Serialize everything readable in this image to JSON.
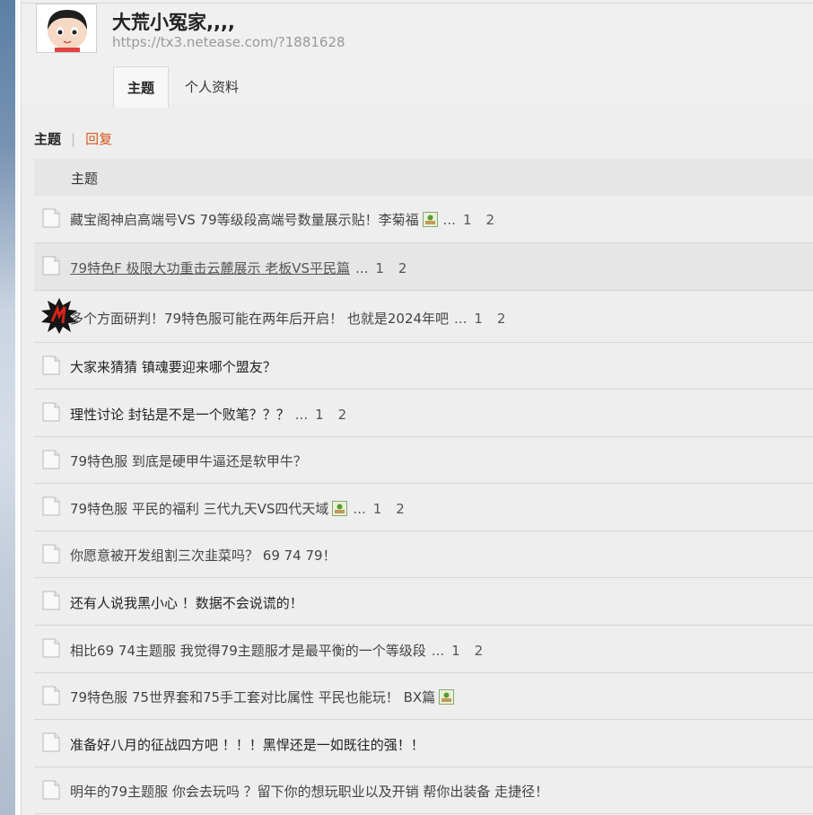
{
  "user": {
    "name": "大荒小冤家,,,,",
    "url": "https://tx3.netease.com/?1881628"
  },
  "tabs": [
    {
      "label": "主题",
      "active": true
    },
    {
      "label": "个人资料",
      "active": false
    }
  ],
  "subnav": {
    "main": "主题",
    "separator": "|",
    "reply": "回复"
  },
  "table": {
    "header": "主题"
  },
  "rows": [
    {
      "title": "藏宝阁神启高端号VS 79等级段高端号数量展示贴！李菊福",
      "has_image": true,
      "ellipsis": "...",
      "pages": [
        "1",
        "2"
      ]
    },
    {
      "title": "79特色F 极限大功重击云麓展示 老板VS平民篇",
      "ellipsis": "...",
      "pages": [
        "1",
        "2"
      ]
    },
    {
      "title": "多个方面研判！79特色服可能在两年后开启！ 也就是2024年吧",
      "ellipsis": "...",
      "pages": [
        "1",
        "2"
      ]
    },
    {
      "title": "大家来猜猜 镇魂要迎来哪个盟友？"
    },
    {
      "title": "理性讨论 封钻是不是一个败笔？？？",
      "ellipsis": "...",
      "pages": [
        "1",
        "2"
      ]
    },
    {
      "title": "79特色服 到底是硬甲牛逼还是软甲牛？"
    },
    {
      "title": "79特色服 平民的福利 三代九天VS四代天域",
      "has_image": true,
      "ellipsis": "...",
      "pages": [
        "1",
        "2"
      ]
    },
    {
      "title": "你愿意被开发组割三次韭菜吗？ 69 74 79！"
    },
    {
      "title": "还有人说我黑小心 ！数据不会说谎的！"
    },
    {
      "title": "相比69 74主题服 我觉得79主题服才是最平衡的一个等级段",
      "ellipsis": "...",
      "pages": [
        "1",
        "2"
      ]
    },
    {
      "title": "79特色服 75世界套和75手工套对比属性 平民也能玩！ BX篇",
      "has_image": true
    },
    {
      "title": "准备好八月的征战四方吧 ！！！黑悍还是一如既往的强！！"
    },
    {
      "title": "明年的79主题服 你会去玩吗 ？留下你的想玩职业以及开销 帮你出装备 走捷径！"
    }
  ]
}
